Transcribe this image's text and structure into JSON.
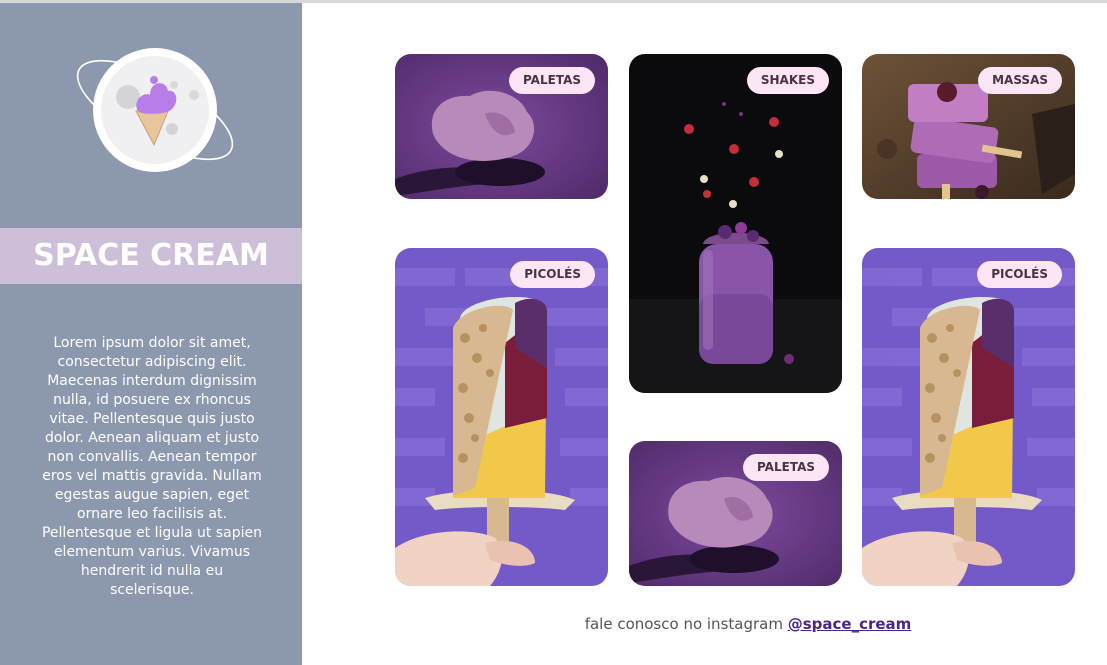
{
  "brand": {
    "title": "SPACE CREAM",
    "description": "Lorem ipsum dolor sit amet, consectetur adipiscing elit. Maecenas interdum dignissim nulla, id posuere ex rhoncus vitae. Pellentesque quis justo dolor. Aenean aliquam et justo non convallis. Aenean tempor eros vel mattis gravida. Nullam egestas augue sapien, eget ornare leo facilisis at. Pellentesque et ligula ut sapien elementum varius. Vivamus hendrerit id nulla eu scelerisque."
  },
  "cards": [
    {
      "label": "PALETAS",
      "image": "scoop-photo"
    },
    {
      "label": "SHAKES",
      "image": "shake-jar-photo"
    },
    {
      "label": "MASSAS",
      "image": "stacked-popsicles-photo"
    },
    {
      "label": "PICOLÉS",
      "image": "popsicle-photo"
    },
    {
      "label": "PALETAS",
      "image": "scoop-photo"
    },
    {
      "label": "PICOLÉS",
      "image": "popsicle-photo"
    }
  ],
  "footer": {
    "text": "fale conosco no instagram",
    "link": "@space_cream"
  },
  "colors": {
    "sidebar": "#8c98ae",
    "band": "#cdbfd8",
    "tag": "#fce6f5",
    "link": "#4b2683"
  }
}
